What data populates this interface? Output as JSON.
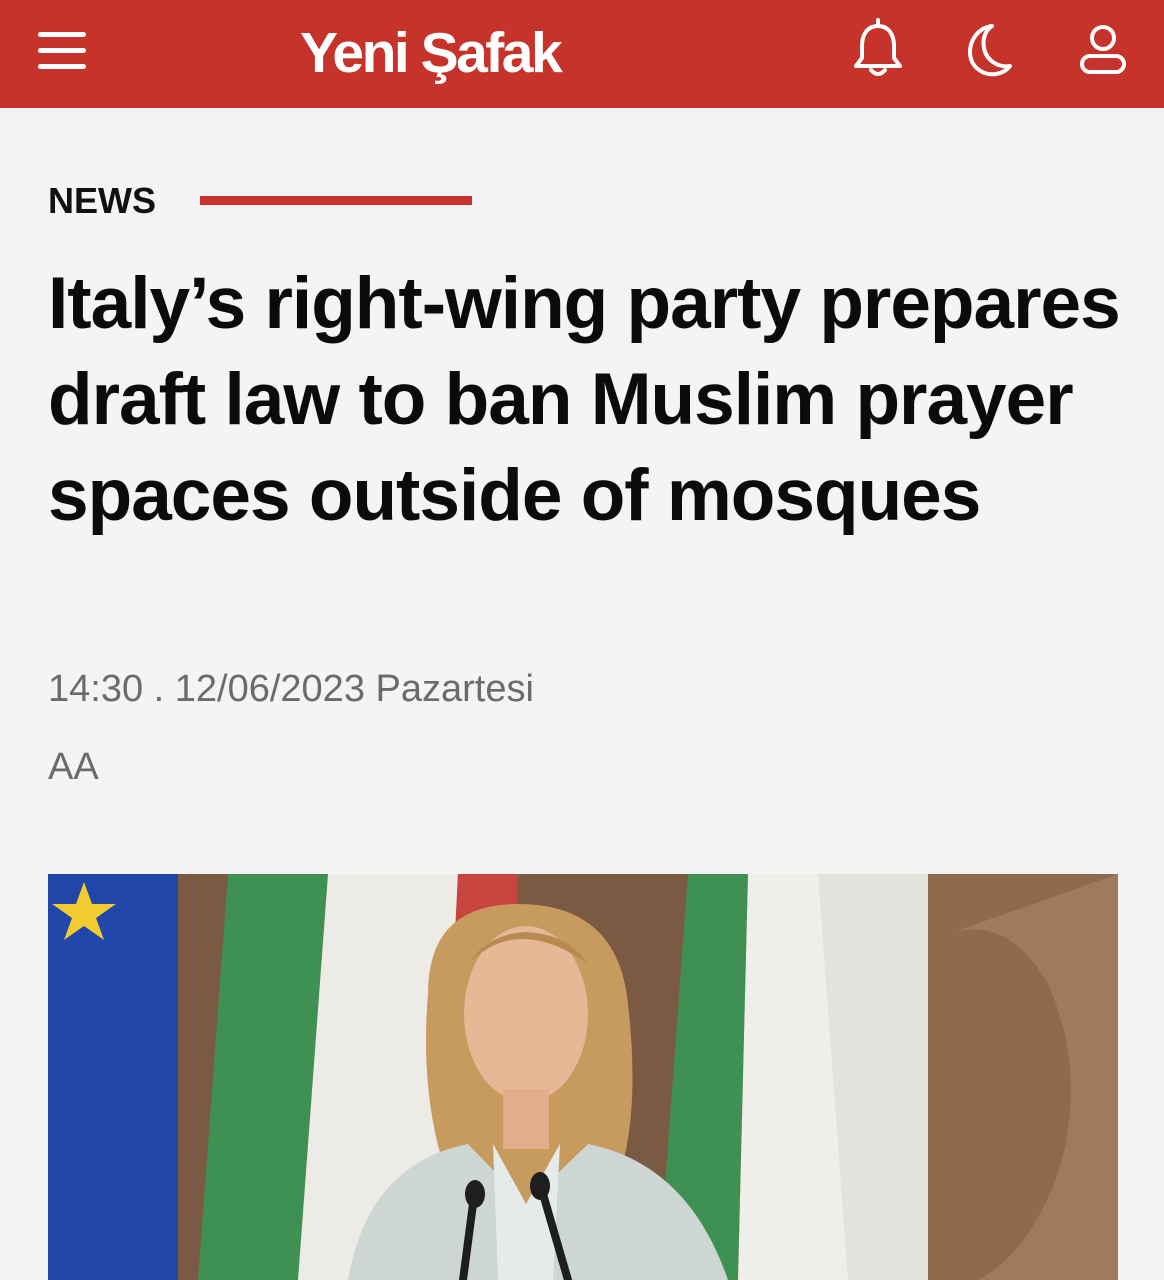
{
  "header": {
    "logo_text": "Yeni Şafak",
    "background_color": "#c5332b",
    "icons": [
      "menu-icon",
      "bell-icon",
      "moon-icon",
      "user-icon"
    ]
  },
  "article": {
    "category": "NEWS",
    "headline": "Italy’s right-wing party prepares draft law to ban Muslim prayer spaces outside of mosques",
    "datetime": "14:30 . 12/06/2023 Pazartesi",
    "source": "AA"
  },
  "colors": {
    "accent": "#c5332b",
    "page_background": "#f4f3f5",
    "meta_text": "#6b6b6b"
  }
}
